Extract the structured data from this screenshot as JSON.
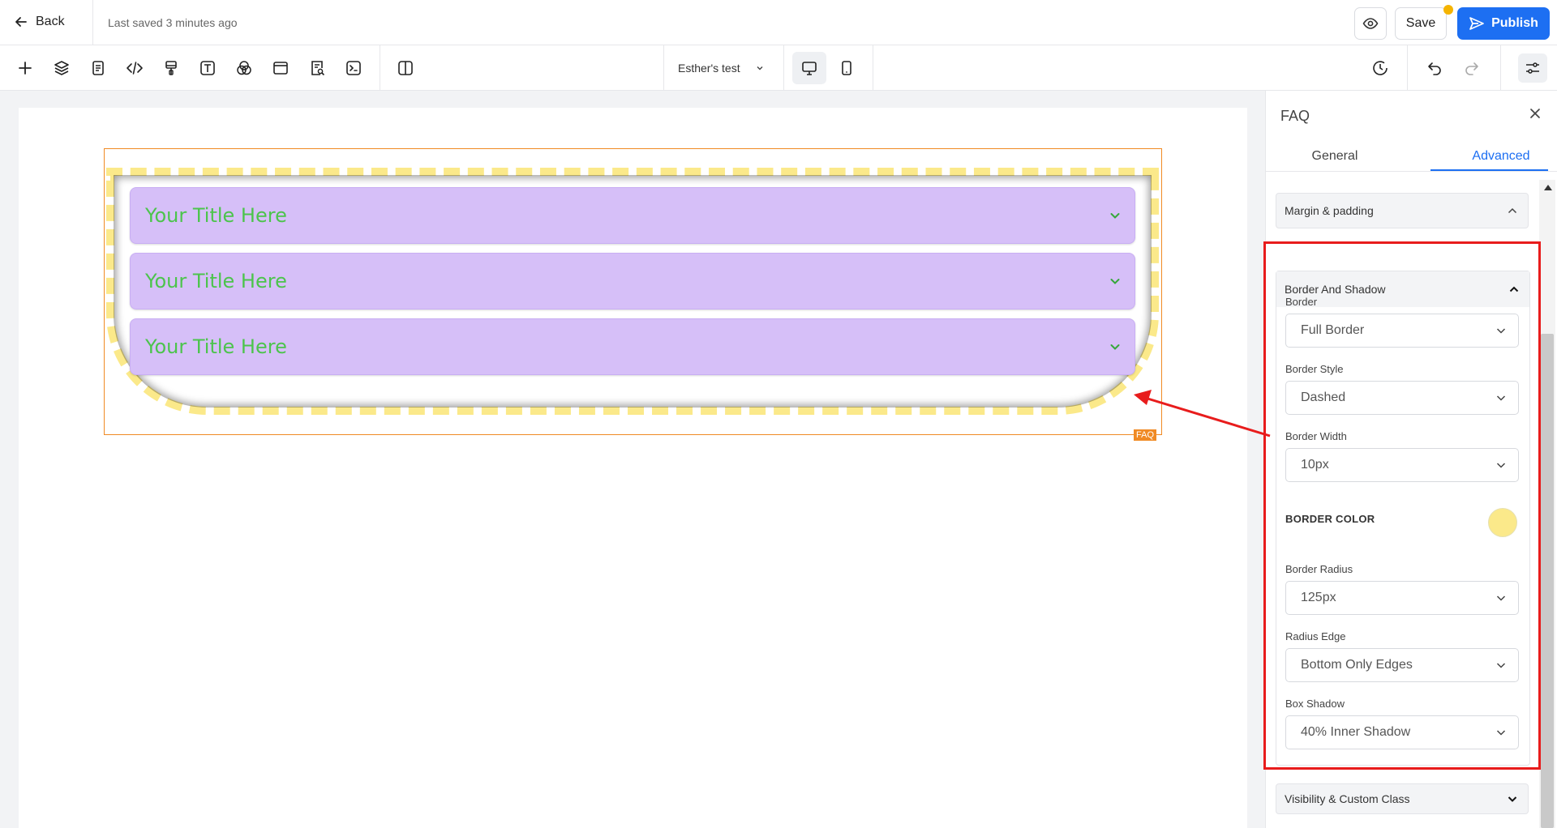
{
  "header": {
    "back_label": "Back",
    "saved_status": "Last saved 3 minutes ago",
    "save_label": "Save",
    "publish_label": "Publish",
    "publish_color": "#1d6ff2"
  },
  "toolbar": {
    "tools": [
      "add-icon",
      "layers-icon",
      "page-icon",
      "code-icon",
      "paint-icon",
      "text-icon",
      "colors-icon",
      "layout-icon",
      "search-doc-icon",
      "terminal-icon",
      "split-view-icon"
    ],
    "page_select": "Esther's test",
    "right_tools": [
      "history-icon",
      "undo-icon",
      "redo-icon",
      "settings-sliders-icon"
    ]
  },
  "canvas": {
    "faq_tag": "FAQ",
    "faq_items": [
      {
        "title": "Your Title Here"
      },
      {
        "title": "Your Title Here"
      },
      {
        "title": "Your Title Here"
      }
    ],
    "faq_item_bg": "#d6bff8",
    "faq_title_color": "#4cc44c",
    "border_color": "#fbe98a"
  },
  "panel": {
    "title": "FAQ",
    "tabs": {
      "general": "General",
      "advanced": "Advanced"
    },
    "active_tab": "Advanced",
    "sections": {
      "margin_padding": "Margin & padding",
      "border_shadow": "Border And Shadow",
      "visibility": "Visibility & Custom Class"
    },
    "fields": {
      "border": {
        "label": "Border",
        "value": "Full Border"
      },
      "border_style": {
        "label": "Border Style",
        "value": "Dashed"
      },
      "border_width": {
        "label": "Border Width",
        "value": "10px"
      },
      "border_color": {
        "label": "BORDER COLOR",
        "value": "#fbe98a"
      },
      "border_radius": {
        "label": "Border Radius",
        "value": "125px"
      },
      "radius_edge": {
        "label": "Radius Edge",
        "value": "Bottom Only Edges"
      },
      "box_shadow": {
        "label": "Box Shadow",
        "value": "40% Inner Shadow"
      }
    }
  }
}
